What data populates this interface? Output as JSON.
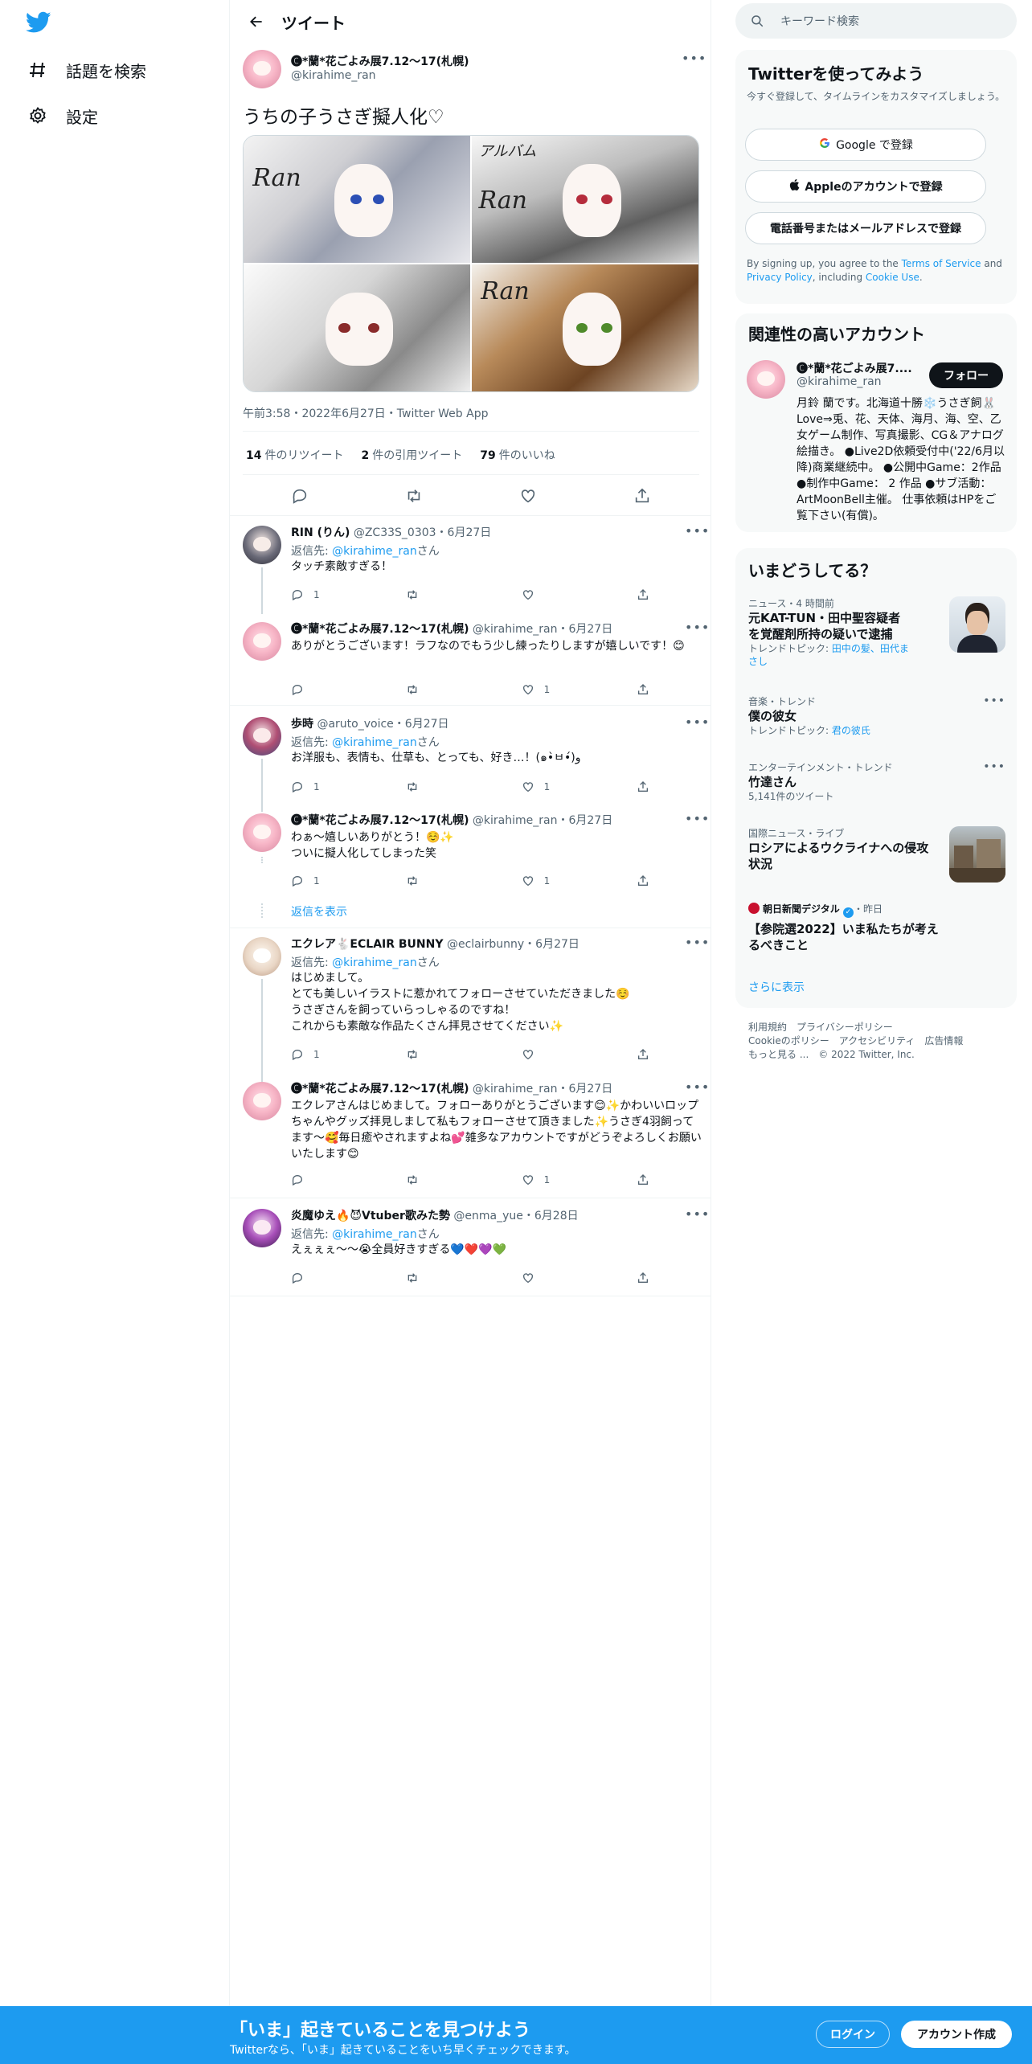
{
  "nav": {
    "explore": "話題を検索",
    "settings": "設定"
  },
  "header": {
    "title": "ツイート"
  },
  "tweet": {
    "name": "🅒*蘭*花ごよみ展7.12～17(札幌)",
    "handle": "@kirahime_ran",
    "text": "うちの子うさぎ擬人化♡",
    "meta": "午前3:58・2022年6月27日・Twitter Web App",
    "retweets": "14",
    "retweets_label": "件のリツイート",
    "quotes": "2",
    "quotes_label": "件の引用ツイート",
    "likes": "79",
    "likes_label": "件のいいね",
    "image_signatures": [
      "Ran",
      "Ran",
      "",
      "Ran"
    ],
    "image_caption": "アルバム"
  },
  "replies": [
    {
      "name": "RIN (りん)",
      "handle": "@ZC33S_0303",
      "date": "・6月27日",
      "to_label": "返信先:",
      "to_handle": "@kirahime_ran",
      "to_suffix": "さん",
      "text": "タッチ素敵すぎる！",
      "reply_count": "1",
      "retweet_count": "",
      "like_count": ""
    },
    {
      "name": "🅒*蘭*花ごよみ展7.12～17(札幌)",
      "handle": "@kirahime_ran",
      "date": "・6月27日",
      "text": "ありがとうございます！ラフなのでもう少し練ったりしますが嬉しいです！😊",
      "reply_count": "",
      "retweet_count": "",
      "like_count": "1"
    },
    {
      "name": "歩時",
      "handle": "@aruto_voice",
      "date": "・6月27日",
      "to_label": "返信先:",
      "to_handle": "@kirahime_ran",
      "to_suffix": "さん",
      "text": "お洋服も、表情も、仕草も、とっても、好き…！(๑•̀ㅂ•́)و",
      "reply_count": "1",
      "retweet_count": "",
      "like_count": "1"
    },
    {
      "name": "🅒*蘭*花ごよみ展7.12～17(札幌)",
      "handle": "@kirahime_ran",
      "date": "・6月27日",
      "text_l1": "わぁ〜嬉しいありがとう！☺️✨",
      "text_l2": "ついに擬人化してしまった笑",
      "reply_count": "1",
      "retweet_count": "",
      "like_count": "1"
    },
    {
      "show_replies": "返信を表示"
    },
    {
      "name": "エクレア🐇ECLAIR BUNNY",
      "handle": "@eclairbunny",
      "date": "・6月27日",
      "to_label": "返信先:",
      "to_handle": "@kirahime_ran",
      "to_suffix": "さん",
      "text_l1": "はじめまして。",
      "text_l2": "とても美しいイラストに惹かれてフォローさせていただきました☺️",
      "text_l3": "うさぎさんを飼っていらっしゃるのですね！",
      "text_l4": "これからも素敵な作品たくさん拝見させてください✨",
      "reply_count": "1",
      "retweet_count": "",
      "like_count": ""
    },
    {
      "name": "🅒*蘭*花ごよみ展7.12～17(札幌)",
      "handle": "@kirahime_ran",
      "date": "・6月27日",
      "text": "エクレアさんはじめまして。フォローありがとうございます😊✨かわいいロップちゃんやグッズ拝見しまして私もフォローさせて頂きました✨うさぎ4羽飼ってます〜🥰毎日癒やされますよね💕雑多なアカウントですがどうぞよろしくお願いいたします😊",
      "reply_count": "",
      "retweet_count": "",
      "like_count": "1"
    },
    {
      "name": "炎魔ゆえ🔥😈Vtuber歌みた勢",
      "handle": "@enma_yue",
      "date": "・6月28日",
      "to_label": "返信先:",
      "to_handle": "@kirahime_ran",
      "to_suffix": "さん",
      "text": "えぇぇぇ〜〜😭全員好きすぎる💙❤️💜💚",
      "reply_count": "",
      "retweet_count": "",
      "like_count": ""
    }
  ],
  "search": {
    "placeholder": "キーワード検索"
  },
  "signup_card": {
    "title": "Twitterを使ってみよう",
    "desc": "今すぐ登録して、タイムラインをカスタマイズしましょう。",
    "google": "Google で登録",
    "apple": "Appleのアカウントで登録",
    "phone": "電話番号またはメールアドレスで登録",
    "legal_pre": "By signing up, you agree to the ",
    "terms": "Terms of Service",
    "legal_and": " and ",
    "privacy": "Privacy Policy",
    "legal_inc": ", including ",
    "cookie": "Cookie Use",
    "legal_end": "."
  },
  "related": {
    "title": "関連性の高いアカウント",
    "name": "🅒*蘭*花ごよみ展7....",
    "handle": "@kirahime_ran",
    "follow": "フォロー",
    "bio": "月鈴 蘭です。北海道十勝❄️うさぎ飼🐰 Love⇒兎、花、天体、海月、海、空、乙女ゲーム制作、写真撮影、CG＆アナログ絵描き。 ●Live2D依頼受付中('22/6月以降)商業継続中。 ●公開中Game：2作品 ●制作中Game： 2 作品 ●サブ活動：ArtMoonBell主催。 仕事依頼はHPをご覧下さい(有償)。"
  },
  "trends": {
    "title": "いまどうしてる？",
    "items": [
      {
        "kind": "ニュース・4 時間前",
        "title": "元KAT-TUN・田中聖容疑者を覚醒剤所持の疑いで逮捕",
        "sub_label": "トレンドトピック: ",
        "sub_link": "田中の髪、田代まさし"
      },
      {
        "kind": "音楽・トレンド",
        "title": "僕の彼女",
        "sub_label": "トレンドトピック: ",
        "sub_link": "君の彼氏"
      },
      {
        "kind": "エンターテインメント・トレンド",
        "title": "竹達さん",
        "sub": "5,141件のツイート"
      },
      {
        "kind": "国際ニュース・ライブ",
        "title": "ロシアによるウクライナへの侵攻状況"
      },
      {
        "source": "朝日新聞デジタル",
        "time": "・昨日",
        "title": "【参院選2022】いま私たちが考えるべきこと"
      }
    ],
    "more": "さらに表示"
  },
  "footer": {
    "terms": "利用規約",
    "privacy": "プライバシーポリシー",
    "cookie": "Cookieのポリシー",
    "access": "アクセシビリティ",
    "ads": "広告情報",
    "more": "もっと見る ...",
    "copy": "© 2022 Twitter, Inc."
  },
  "bottom": {
    "title": "「いま」起きていることを見つけよう",
    "sub": "Twitterなら、「いま」起きていることをいち早くチェックできます。",
    "login": "ログイン",
    "signup": "アカウント作成"
  },
  "colors": {
    "accent": "#1d9bf0",
    "text": "#0f1419",
    "muted": "#536471",
    "border": "#eff3f4"
  }
}
